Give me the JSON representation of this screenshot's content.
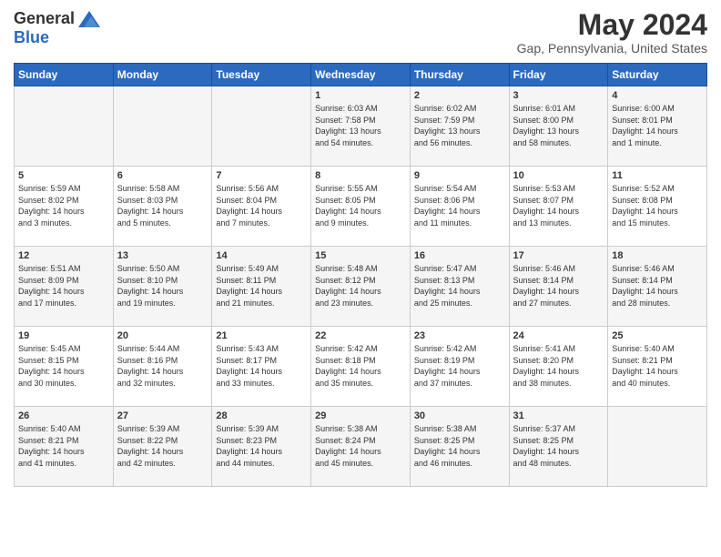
{
  "header": {
    "logo_general": "General",
    "logo_blue": "Blue",
    "title": "May 2024",
    "subtitle": "Gap, Pennsylvania, United States"
  },
  "days_of_week": [
    "Sunday",
    "Monday",
    "Tuesday",
    "Wednesday",
    "Thursday",
    "Friday",
    "Saturday"
  ],
  "weeks": [
    [
      {
        "day": "",
        "info": ""
      },
      {
        "day": "",
        "info": ""
      },
      {
        "day": "",
        "info": ""
      },
      {
        "day": "1",
        "info": "Sunrise: 6:03 AM\nSunset: 7:58 PM\nDaylight: 13 hours\nand 54 minutes."
      },
      {
        "day": "2",
        "info": "Sunrise: 6:02 AM\nSunset: 7:59 PM\nDaylight: 13 hours\nand 56 minutes."
      },
      {
        "day": "3",
        "info": "Sunrise: 6:01 AM\nSunset: 8:00 PM\nDaylight: 13 hours\nand 58 minutes."
      },
      {
        "day": "4",
        "info": "Sunrise: 6:00 AM\nSunset: 8:01 PM\nDaylight: 14 hours\nand 1 minute."
      }
    ],
    [
      {
        "day": "5",
        "info": "Sunrise: 5:59 AM\nSunset: 8:02 PM\nDaylight: 14 hours\nand 3 minutes."
      },
      {
        "day": "6",
        "info": "Sunrise: 5:58 AM\nSunset: 8:03 PM\nDaylight: 14 hours\nand 5 minutes."
      },
      {
        "day": "7",
        "info": "Sunrise: 5:56 AM\nSunset: 8:04 PM\nDaylight: 14 hours\nand 7 minutes."
      },
      {
        "day": "8",
        "info": "Sunrise: 5:55 AM\nSunset: 8:05 PM\nDaylight: 14 hours\nand 9 minutes."
      },
      {
        "day": "9",
        "info": "Sunrise: 5:54 AM\nSunset: 8:06 PM\nDaylight: 14 hours\nand 11 minutes."
      },
      {
        "day": "10",
        "info": "Sunrise: 5:53 AM\nSunset: 8:07 PM\nDaylight: 14 hours\nand 13 minutes."
      },
      {
        "day": "11",
        "info": "Sunrise: 5:52 AM\nSunset: 8:08 PM\nDaylight: 14 hours\nand 15 minutes."
      }
    ],
    [
      {
        "day": "12",
        "info": "Sunrise: 5:51 AM\nSunset: 8:09 PM\nDaylight: 14 hours\nand 17 minutes."
      },
      {
        "day": "13",
        "info": "Sunrise: 5:50 AM\nSunset: 8:10 PM\nDaylight: 14 hours\nand 19 minutes."
      },
      {
        "day": "14",
        "info": "Sunrise: 5:49 AM\nSunset: 8:11 PM\nDaylight: 14 hours\nand 21 minutes."
      },
      {
        "day": "15",
        "info": "Sunrise: 5:48 AM\nSunset: 8:12 PM\nDaylight: 14 hours\nand 23 minutes."
      },
      {
        "day": "16",
        "info": "Sunrise: 5:47 AM\nSunset: 8:13 PM\nDaylight: 14 hours\nand 25 minutes."
      },
      {
        "day": "17",
        "info": "Sunrise: 5:46 AM\nSunset: 8:14 PM\nDaylight: 14 hours\nand 27 minutes."
      },
      {
        "day": "18",
        "info": "Sunrise: 5:46 AM\nSunset: 8:14 PM\nDaylight: 14 hours\nand 28 minutes."
      }
    ],
    [
      {
        "day": "19",
        "info": "Sunrise: 5:45 AM\nSunset: 8:15 PM\nDaylight: 14 hours\nand 30 minutes."
      },
      {
        "day": "20",
        "info": "Sunrise: 5:44 AM\nSunset: 8:16 PM\nDaylight: 14 hours\nand 32 minutes."
      },
      {
        "day": "21",
        "info": "Sunrise: 5:43 AM\nSunset: 8:17 PM\nDaylight: 14 hours\nand 33 minutes."
      },
      {
        "day": "22",
        "info": "Sunrise: 5:42 AM\nSunset: 8:18 PM\nDaylight: 14 hours\nand 35 minutes."
      },
      {
        "day": "23",
        "info": "Sunrise: 5:42 AM\nSunset: 8:19 PM\nDaylight: 14 hours\nand 37 minutes."
      },
      {
        "day": "24",
        "info": "Sunrise: 5:41 AM\nSunset: 8:20 PM\nDaylight: 14 hours\nand 38 minutes."
      },
      {
        "day": "25",
        "info": "Sunrise: 5:40 AM\nSunset: 8:21 PM\nDaylight: 14 hours\nand 40 minutes."
      }
    ],
    [
      {
        "day": "26",
        "info": "Sunrise: 5:40 AM\nSunset: 8:21 PM\nDaylight: 14 hours\nand 41 minutes."
      },
      {
        "day": "27",
        "info": "Sunrise: 5:39 AM\nSunset: 8:22 PM\nDaylight: 14 hours\nand 42 minutes."
      },
      {
        "day": "28",
        "info": "Sunrise: 5:39 AM\nSunset: 8:23 PM\nDaylight: 14 hours\nand 44 minutes."
      },
      {
        "day": "29",
        "info": "Sunrise: 5:38 AM\nSunset: 8:24 PM\nDaylight: 14 hours\nand 45 minutes."
      },
      {
        "day": "30",
        "info": "Sunrise: 5:38 AM\nSunset: 8:25 PM\nDaylight: 14 hours\nand 46 minutes."
      },
      {
        "day": "31",
        "info": "Sunrise: 5:37 AM\nSunset: 8:25 PM\nDaylight: 14 hours\nand 48 minutes."
      },
      {
        "day": "",
        "info": ""
      }
    ]
  ]
}
